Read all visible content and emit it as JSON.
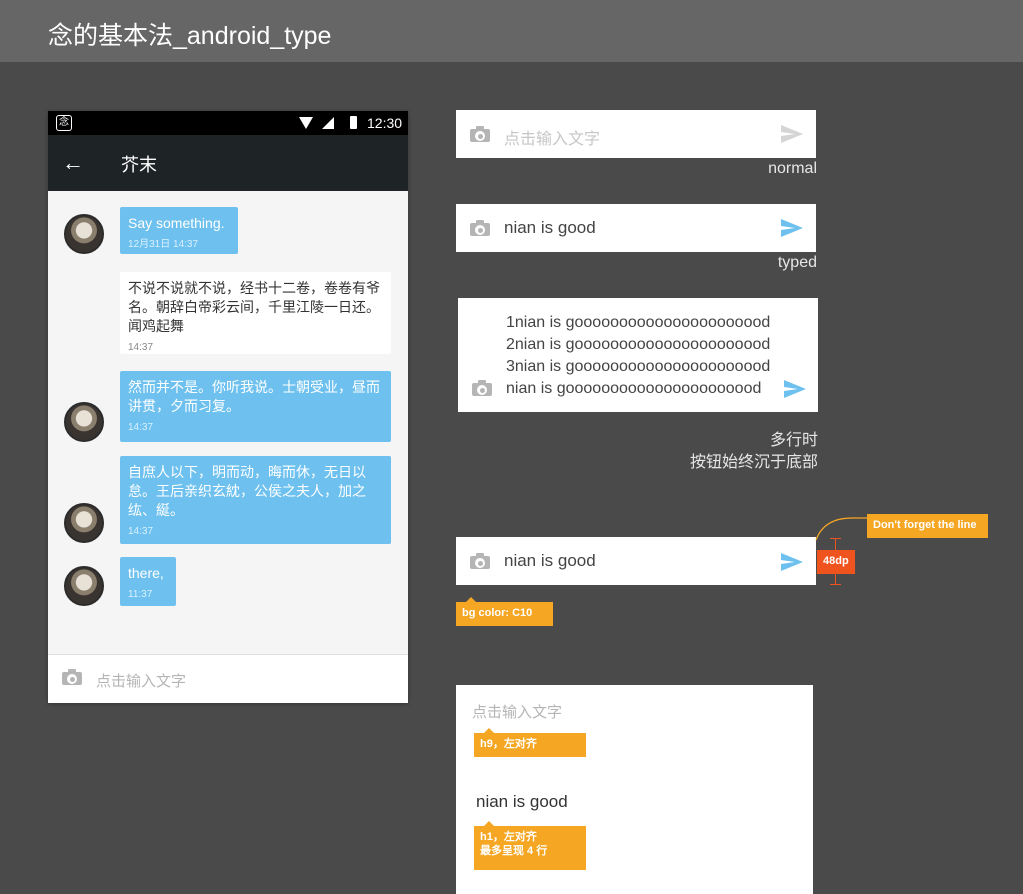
{
  "page": {
    "title": "念的基本法_android_type"
  },
  "phone": {
    "status": {
      "app_glyph": "念",
      "time": "12:30"
    },
    "appbar": {
      "title": "芥末"
    },
    "messages": [
      {
        "text": "Say something.",
        "time": "12月31日 14:37"
      },
      {
        "text": "不说不说就不说，经书十二卷，卷卷有爷名。朝辞白帝彩云间，千里江陵一日还。闻鸡起舞",
        "time": "14:37"
      },
      {
        "text": "然而并不是。你听我说。士朝受业，昼而讲贯，夕而习复。",
        "time": "14:37"
      },
      {
        "text": "自庶人以下，明而动，晦而休，无日以怠。王后亲织玄紞，公侯之夫人，加之纮、綖。",
        "time": "14:37"
      },
      {
        "text": "there,",
        "time": "11:37"
      }
    ],
    "input_placeholder": "点击输入文字"
  },
  "states": {
    "normal": {
      "placeholder": "点击输入文字",
      "caption": "normal"
    },
    "typed": {
      "value": "nian is good",
      "caption": "typed"
    },
    "multiline": {
      "lines": [
        "1nian is goooooooooooooooooooood",
        "2nian is goooooooooooooooooooood",
        "3nian is goooooooooooooooooooood",
        "nian is goooooooooooooooooooood"
      ],
      "caption_line1": "多行时",
      "caption_line2": "按钮始终沉于底部"
    },
    "annotated": {
      "value": "nian is good",
      "tag_line": "Don't forget the line",
      "tag_height": "48dp",
      "tag_bg": "bg color: C10"
    }
  },
  "spec": {
    "placeholder": "点击输入文字",
    "placeholder_note": "h9，左对齐",
    "value": "nian is good",
    "value_note_1": "h1，左对齐",
    "value_note_2": "最多呈现 4 行"
  },
  "colors": {
    "accent_blue": "#6ec1ef",
    "tag_orange": "#f5a623",
    "tag_red": "#f0541e",
    "bg": "#4a4a4a"
  }
}
